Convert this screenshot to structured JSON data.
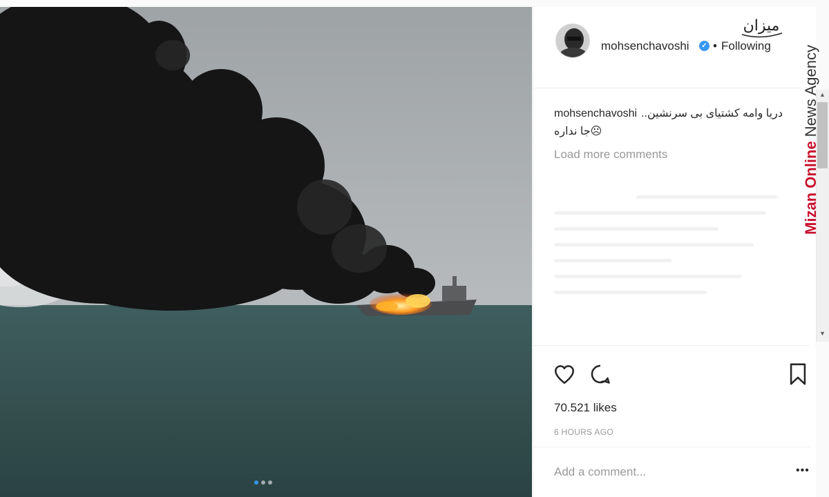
{
  "post": {
    "username": "mohsenchavoshi",
    "following_label": "Following",
    "dot": "•",
    "verified_mark": "✓",
    "caption_line1": "دریا وامه کشتیای بی سرنشین..",
    "caption_line2": "جا نداره☹",
    "load_more_label": "Load more comments",
    "likes_label": "70.521 likes",
    "timestamp": "6 HOURS AGO",
    "comment_placeholder": "Add a comment...",
    "more_label": "•••",
    "carousel": {
      "total": 3,
      "active_index": 0
    }
  },
  "watermark": {
    "logo_text": "میزان",
    "brand": "Mizan Online",
    "suffix": "News Agency"
  },
  "scrollbar": {
    "up": "▲",
    "down": "▼"
  },
  "icons": {
    "like": "heart-outline",
    "comment": "speech-bubble",
    "save": "bookmark",
    "verified": "verified-badge",
    "more": "ellipsis"
  }
}
